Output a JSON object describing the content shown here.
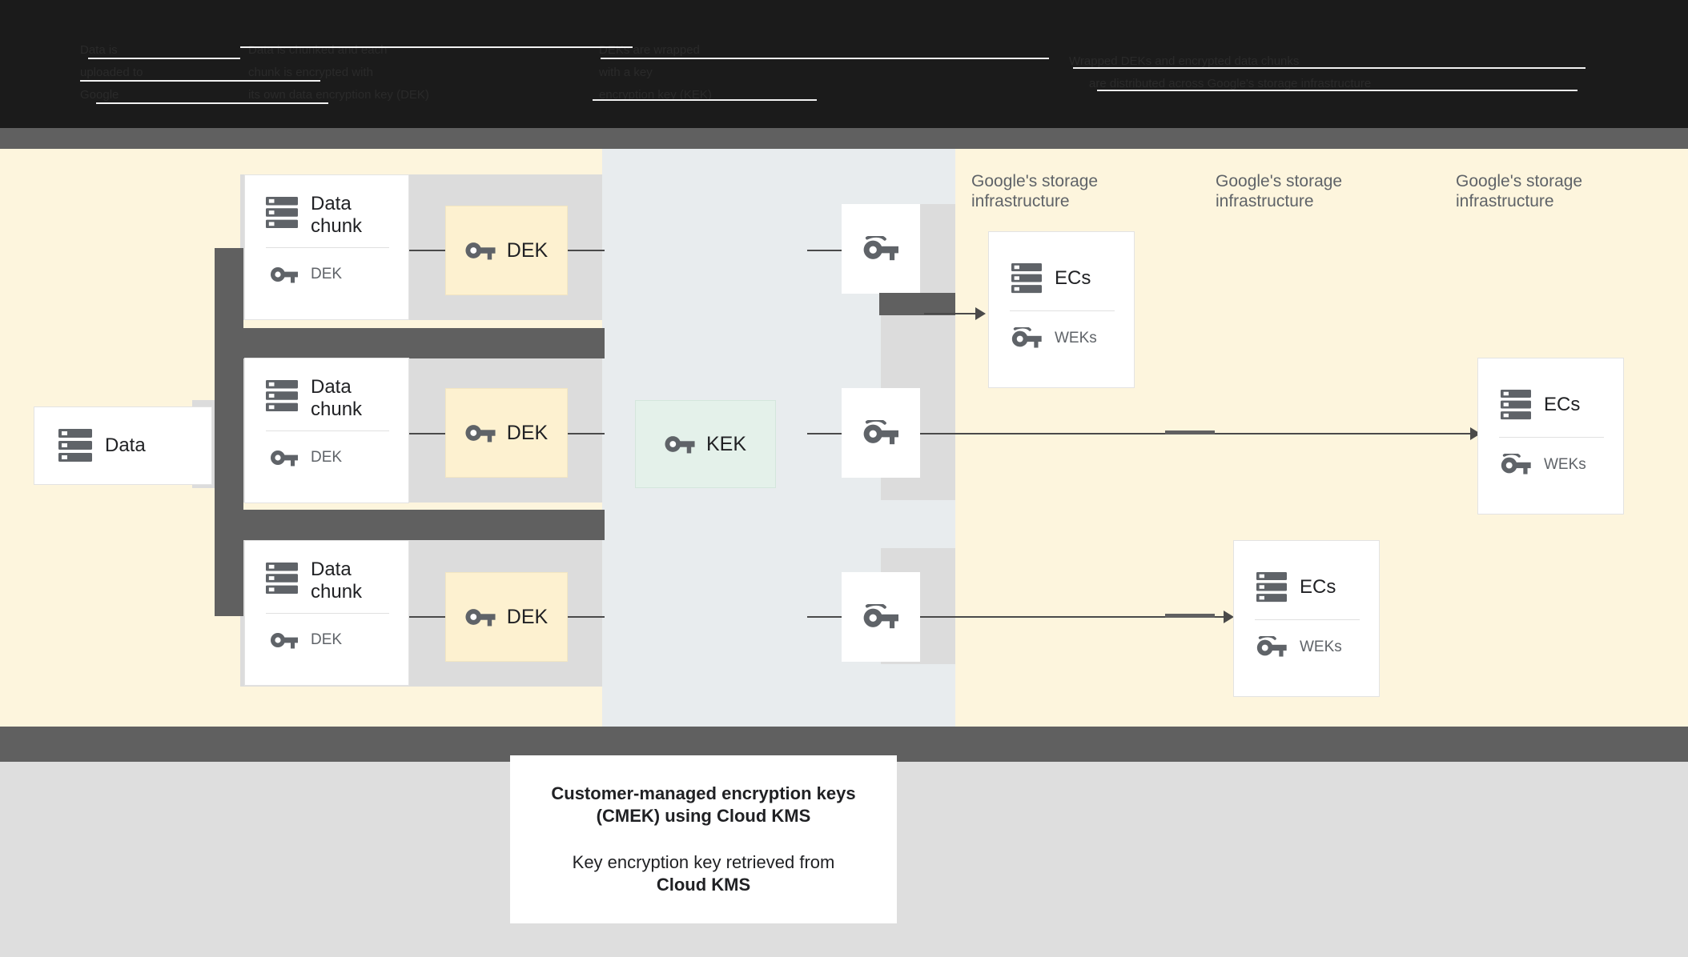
{
  "header": {
    "obscured_note": "header text rendered dark-on-black, illegible",
    "lines": [
      "Data is",
      "uploaded to",
      "Google",
      "Data is chunked and each",
      "chunk is encrypted with",
      "its own data encryption key (DEK)",
      "DEKs are wrapped",
      "with a key",
      "encryption key (KEK)",
      "Wrapped DEKs and encrypted data chunks",
      "are distributed across Google's storage infrastructure"
    ]
  },
  "diagram": {
    "source": {
      "label": "Data",
      "icon": "storage-icon"
    },
    "chunks": [
      {
        "title": "Data\nchunk",
        "icon": "storage-icon",
        "key_label": "DEK",
        "key_icon": "key-icon"
      },
      {
        "title": "Data\nchunk",
        "icon": "storage-icon",
        "key_label": "DEK",
        "key_icon": "key-icon"
      },
      {
        "title": "Data\nchunk",
        "icon": "storage-icon",
        "key_label": "DEK",
        "key_icon": "key-icon"
      }
    ],
    "dek_chips": [
      {
        "label": "DEK",
        "icon": "key-icon"
      },
      {
        "label": "DEK",
        "icon": "key-icon"
      },
      {
        "label": "DEK",
        "icon": "key-icon"
      }
    ],
    "kek_chip": {
      "label": "KEK",
      "icon": "key-icon",
      "color": "#e4f1ea"
    },
    "wrapped_keys": [
      {
        "icon": "key-icon"
      },
      {
        "icon": "key-icon"
      },
      {
        "icon": "key-icon"
      }
    ],
    "region_labels": [
      "Google's storage\ninfrastructure",
      "Google's storage\ninfrastructure",
      "Google's storage\ninfrastructure"
    ],
    "storage_cards": [
      {
        "title": "ECs",
        "icon": "storage-icon",
        "key_label": "WEKs",
        "key_icon": "key-icon"
      },
      {
        "title": "ECs",
        "icon": "storage-icon",
        "key_label": "WEKs",
        "key_icon": "key-icon"
      },
      {
        "title": "ECs",
        "icon": "storage-icon",
        "key_label": "WEKs",
        "key_icon": "key-icon"
      }
    ]
  },
  "caption": {
    "title_line1": "Customer-managed encryption keys",
    "title_line2": "(CMEK) using Cloud KMS",
    "body_line1": "Key encryption key retrieved from",
    "body_line2": "Cloud KMS"
  },
  "colors": {
    "cream": "#fdf5dd",
    "kek_region": "#e8ecee",
    "strip": "#dcdcdc",
    "dark_gray": "#606060",
    "header_black": "#1b1b1b",
    "footer_gray": "#dedede",
    "dek_chip": "#fdf1d0",
    "kek_chip": "#e4f1ea",
    "icon_gray": "#5f6368"
  }
}
